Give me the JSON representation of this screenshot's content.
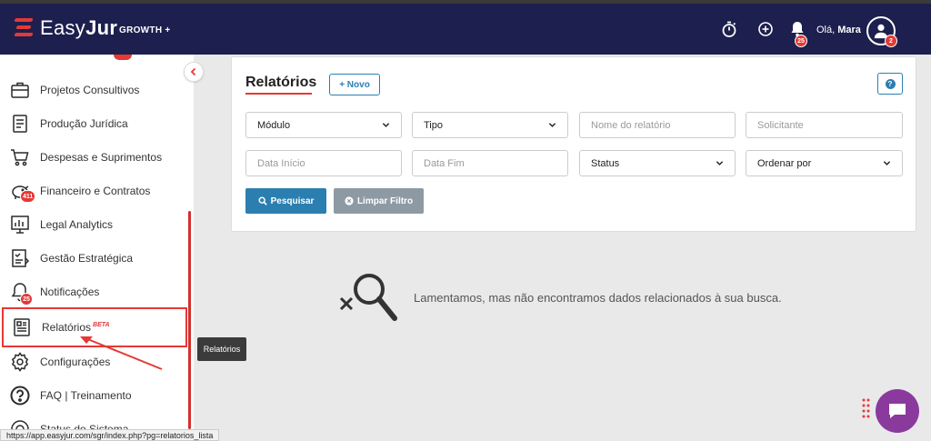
{
  "app": {
    "brand_light": "Easy",
    "brand_bold": "Jur",
    "plan": "GROWTH +",
    "greeting_prefix": "Olá,",
    "user_name": "Mara",
    "notif_count": "25",
    "avatar_badge": "2"
  },
  "sidebar": {
    "items": [
      {
        "label": "Projetos Consultivos",
        "icon": "briefcase-icon"
      },
      {
        "label": "Produção Jurídica",
        "icon": "document-icon"
      },
      {
        "label": "Despesas e Suprimentos",
        "icon": "cart-icon"
      },
      {
        "label": "Financeiro e Contratos",
        "icon": "piggy-bank-icon",
        "badge": "411"
      },
      {
        "label": "Legal Analytics",
        "icon": "analytics-icon"
      },
      {
        "label": "Gestão Estratégica",
        "icon": "strategy-icon"
      },
      {
        "label": "Notificações",
        "icon": "bell-icon",
        "badge": "25"
      },
      {
        "label": "Relatórios",
        "icon": "report-icon",
        "tag": "BETA"
      },
      {
        "label": "Configurações",
        "icon": "gear-icon"
      },
      {
        "label": "FAQ | Treinamento",
        "icon": "question-icon"
      },
      {
        "label": "Status do Sistema",
        "icon": "status-icon"
      }
    ]
  },
  "tooltip": "Relatórios",
  "panel": {
    "title": "Relatórios",
    "new_label": "+ Novo",
    "help_label": "?",
    "filters": {
      "modulo": "Módulo",
      "tipo": "Tipo",
      "nome_placeholder": "Nome do relatório",
      "solicitante_placeholder": "Solicitante",
      "data_inicio_placeholder": "Data Início",
      "data_fim_placeholder": "Data Fim",
      "status": "Status",
      "ordenar": "Ordenar por"
    },
    "search_label": "Pesquisar",
    "clear_label": "Limpar Filtro"
  },
  "empty_message": "Lamentamos, mas não encontramos dados relacionados à sua busca.",
  "status_url": "https://app.easyjur.com/sgr/index.php?pg=relatorios_lista",
  "colors": {
    "topbar": "#1d1f4e",
    "accent_red": "#e53935",
    "primary_blue": "#2b7fb0",
    "chat_purple": "#8a3a9c"
  }
}
